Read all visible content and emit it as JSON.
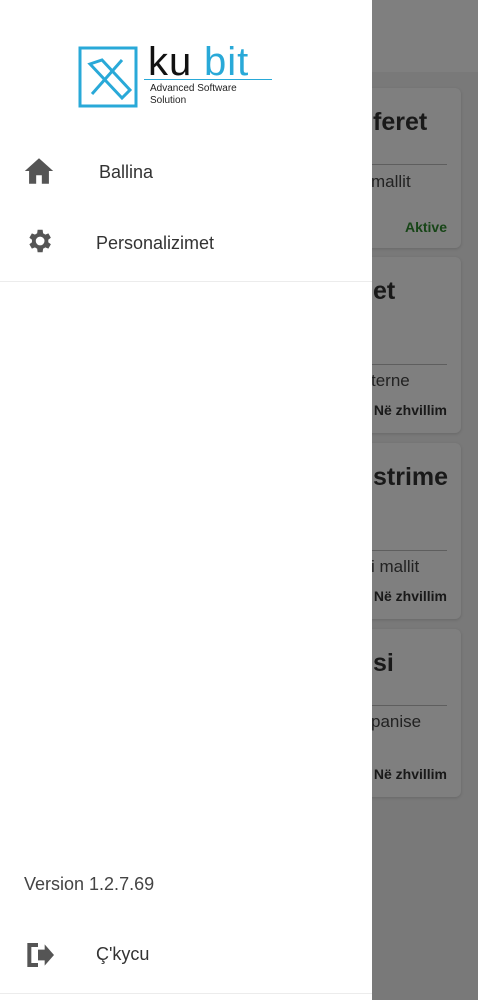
{
  "brand": {
    "wordmark_dark": "ku",
    "wordmark_accent": "bit",
    "tagline_line1": "Advanced Software",
    "tagline_line2": "Solution",
    "accent_color": "#29a9d8"
  },
  "drawer": {
    "items": [
      {
        "label": "Ballina",
        "icon": "home-icon"
      },
      {
        "label": "Personalizimet",
        "icon": "gear-icon"
      }
    ],
    "version": "Version 1.2.7.69",
    "logout": {
      "label": "Ç'kycu",
      "icon": "logout-icon"
    }
  },
  "background_cards": [
    {
      "title": "feret",
      "subtitle": "mallit",
      "status": "Aktive",
      "status_color": "#2e8b2e"
    },
    {
      "title": "et",
      "subtitle": "terne",
      "status": "Në zhvillim"
    },
    {
      "title": "strime",
      "subtitle": "i mallit",
      "status": "Në zhvillim"
    },
    {
      "title": "si",
      "subtitle": "panise",
      "status": "Në zhvillim"
    }
  ]
}
